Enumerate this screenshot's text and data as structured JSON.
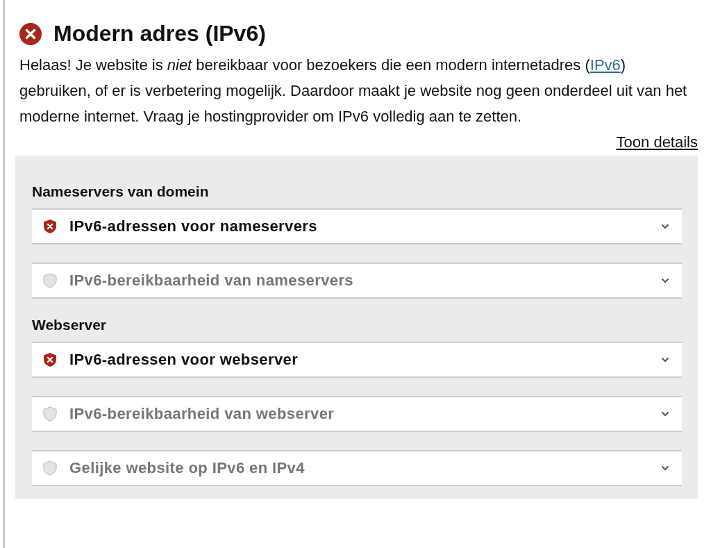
{
  "heading": {
    "title": "Modern adres (IPv6)",
    "kind": "failed"
  },
  "intro": {
    "before": "Helaas! Je website is *niet* bereikbaar voor bezoekers die een modern internetadres (",
    "link": "IPv6",
    "after": ") gebruiken, of er is verbetering mogelijk. Daardoor maakt je website nog geen onderdeel uit van het moderne internet. Vraag je hostingprovider om IPv6 volledig aan te zetten."
  },
  "details_link": "Toon details",
  "sections": [
    {
      "title": "Nameservers van domein",
      "items": [
        {
          "label": "IPv6-adressen voor nameservers",
          "kind": "failed",
          "expanded": false
        },
        {
          "label": "IPv6-bereikbaarheid van nameservers",
          "kind": "neutral",
          "expanded": false
        }
      ]
    },
    {
      "title": "Webserver",
      "items": [
        {
          "label": "IPv6-adressen voor webserver",
          "kind": "failed",
          "expanded": false
        },
        {
          "label": "IPv6-bereikbaarheid van webserver",
          "kind": "neutral",
          "expanded": false
        },
        {
          "label": "Gelijke website op IPv6 en IPv4",
          "kind": "neutral",
          "expanded": false
        }
      ]
    }
  ]
}
